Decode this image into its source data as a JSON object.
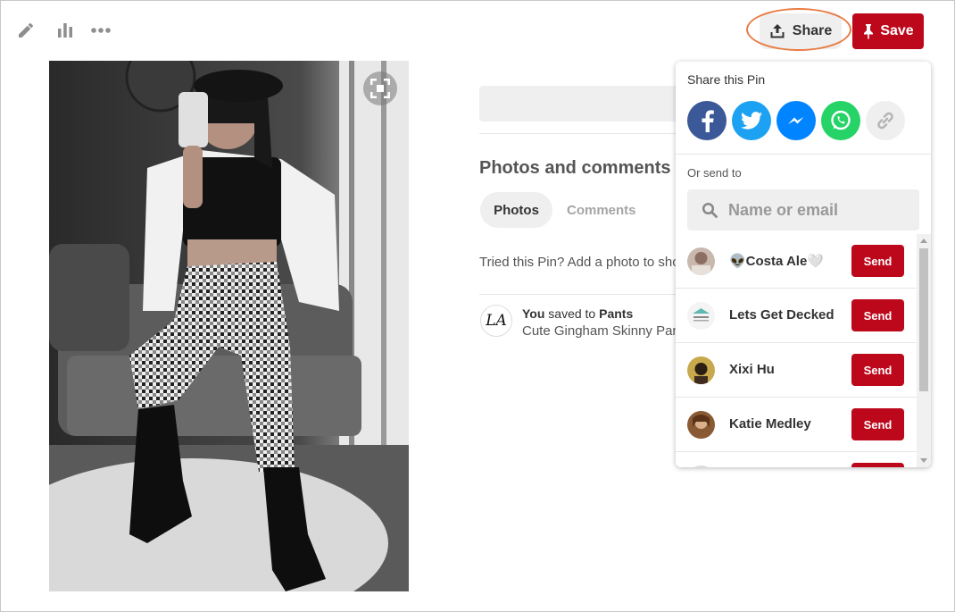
{
  "toolbar": {
    "edit_icon": "pencil-icon",
    "stats_icon": "bar-chart-icon",
    "more_icon": "more-dots-icon",
    "share_label": "Share",
    "save_label": "Save"
  },
  "pin": {
    "image_description": "pin-photo"
  },
  "details": {
    "section_title": "Photos and comments",
    "tabs": [
      {
        "label": "Photos",
        "active": true
      },
      {
        "label": "Comments",
        "active": false
      }
    ],
    "tried_prompt": "Tried this Pin? Add a photo to show",
    "saver_initials": "LA",
    "saver_name": "You",
    "saved_to_text": "saved to",
    "board_name": "Pants",
    "pin_description": "Cute Gingham Skinny Pants"
  },
  "share_popover": {
    "title": "Share this Pin",
    "social_buttons": [
      {
        "name": "facebook",
        "color": "#3b5998"
      },
      {
        "name": "twitter",
        "color": "#1da1f2"
      },
      {
        "name": "messenger",
        "color": "#0084ff"
      },
      {
        "name": "whatsapp",
        "color": "#25d366"
      },
      {
        "name": "copy-link",
        "color": "#efefef"
      }
    ],
    "or_send_to": "Or send to",
    "search_placeholder": "Name or email",
    "send_label": "Send",
    "contacts": [
      {
        "name": "👽Costa Ale🤍"
      },
      {
        "name": "Lets Get Decked"
      },
      {
        "name": "Xixi Hu"
      },
      {
        "name": "Katie Medley"
      },
      {
        "name": ""
      }
    ]
  },
  "colors": {
    "brand_red": "#bd081c",
    "highlight_ring": "#e97c45"
  }
}
